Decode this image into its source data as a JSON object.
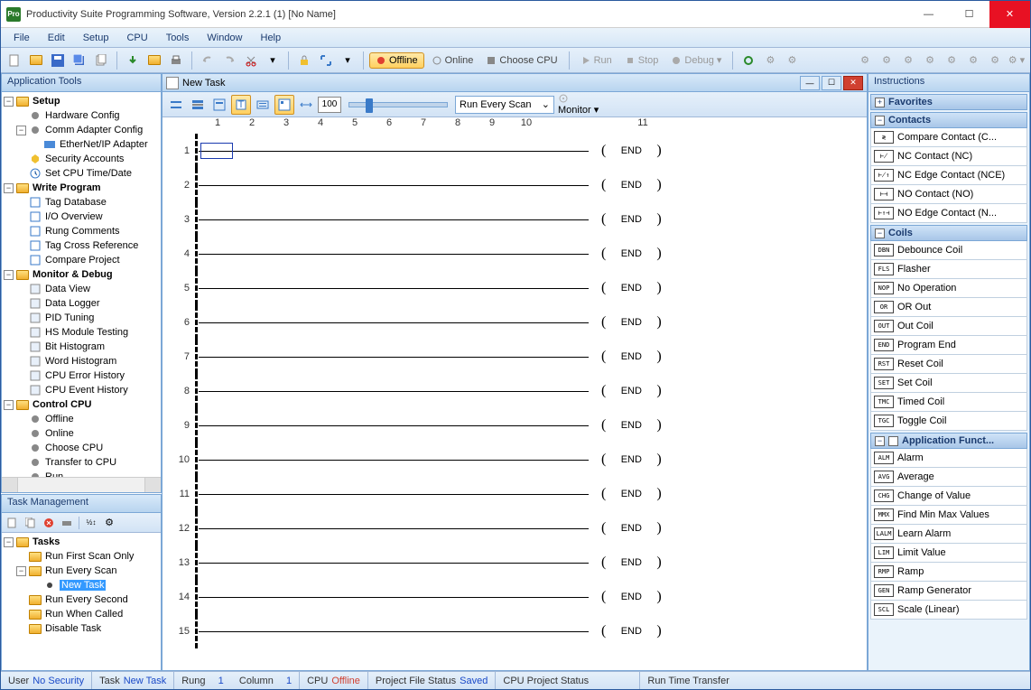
{
  "title": "Productivity Suite Programming Software, Version 2.2.1 (1)   [No Name]",
  "appicon_text": "Pro",
  "menu": [
    "File",
    "Edit",
    "Setup",
    "CPU",
    "Tools",
    "Window",
    "Help"
  ],
  "toolbar_text": {
    "offline": "Offline",
    "online": "Online",
    "choose_cpu": "Choose CPU",
    "run": "Run",
    "stop": "Stop",
    "debug": "Debug"
  },
  "left_panel_title": "Application Tools",
  "tree": {
    "setup": {
      "label": "Setup",
      "items": [
        "Hardware Config",
        "Comm Adapter Config",
        "EtherNet/IP Adapter",
        "Security Accounts",
        "Set CPU Time/Date"
      ]
    },
    "write": {
      "label": "Write Program",
      "items": [
        "Tag Database",
        "I/O Overview",
        "Rung Comments",
        "Tag Cross Reference",
        "Compare Project"
      ]
    },
    "monitor": {
      "label": "Monitor & Debug",
      "items": [
        "Data View",
        "Data Logger",
        "PID Tuning",
        "HS Module Testing",
        "Bit Histogram",
        "Word Histogram",
        "CPU Error History",
        "CPU Event History"
      ]
    },
    "control": {
      "label": "Control CPU",
      "items": [
        "Offline",
        "Online",
        "Choose CPU",
        "Transfer to CPU",
        "Run"
      ]
    }
  },
  "taskmgmt": {
    "title": "Task Management",
    "root": "Tasks",
    "items": [
      "Run First Scan Only",
      "Run Every Scan",
      "New Task",
      "Run Every Second",
      "Run When Called",
      "Disable Task"
    ]
  },
  "doc": {
    "title": "New Task",
    "zoom": "100",
    "combo": "Run Every Scan",
    "monitor": "Monitor",
    "cols": [
      "1",
      "2",
      "3",
      "4",
      "5",
      "6",
      "7",
      "8",
      "9",
      "10",
      "11"
    ],
    "rungs": [
      1,
      2,
      3,
      4,
      5,
      6,
      7,
      8,
      9,
      10,
      11,
      12,
      13,
      14,
      15
    ],
    "end": "END"
  },
  "instr": {
    "title": "Instructions",
    "favorites": "Favorites",
    "contacts": {
      "label": "Contacts",
      "items": [
        {
          "sym": "≷",
          "label": "Compare Contact  (C..."
        },
        {
          "sym": "⊬",
          "label": "NC Contact  (NC)"
        },
        {
          "sym": "⊬↑",
          "label": "NC Edge Contact  (NCE)"
        },
        {
          "sym": "⊢⊣",
          "label": "NO Contact  (NO)"
        },
        {
          "sym": "⊢↑⊣",
          "label": "NO Edge Contact  (N..."
        }
      ]
    },
    "coils": {
      "label": "Coils",
      "items": [
        {
          "sym": "DBN",
          "label": "Debounce Coil"
        },
        {
          "sym": "FLS",
          "label": "Flasher"
        },
        {
          "sym": "NOP",
          "label": "No Operation"
        },
        {
          "sym": "OR",
          "label": "OR Out"
        },
        {
          "sym": "OUT",
          "label": "Out Coil"
        },
        {
          "sym": "END",
          "label": "Program End"
        },
        {
          "sym": "RST",
          "label": "Reset Coil"
        },
        {
          "sym": "SET",
          "label": "Set Coil"
        },
        {
          "sym": "TMC",
          "label": "Timed Coil"
        },
        {
          "sym": "TGC",
          "label": "Toggle Coil"
        }
      ]
    },
    "appfn": {
      "label": "Application Funct...",
      "items": [
        {
          "sym": "ALM",
          "label": "Alarm"
        },
        {
          "sym": "AVG",
          "label": "Average"
        },
        {
          "sym": "CHG",
          "label": "Change of Value"
        },
        {
          "sym": "MMX",
          "label": "Find Min Max Values"
        },
        {
          "sym": "LALM",
          "label": "Learn Alarm"
        },
        {
          "sym": "LIM",
          "label": "Limit Value"
        },
        {
          "sym": "RMP",
          "label": "Ramp"
        },
        {
          "sym": "GEN",
          "label": "Ramp Generator"
        },
        {
          "sym": "SCL",
          "label": "Scale (Linear)"
        }
      ]
    }
  },
  "status": {
    "user_lbl": "User",
    "user_val": "No Security",
    "task_lbl": "Task",
    "task_val": "New Task",
    "rung_lbl": "Rung",
    "rung_val": "1",
    "col_lbl": "Column",
    "col_val": "1",
    "cpu_lbl": "CPU",
    "cpu_val": "Offline",
    "pfs_lbl": "Project File Status",
    "pfs_val": "Saved",
    "cps_lbl": "CPU Project Status",
    "rtt_lbl": "Run Time Transfer"
  }
}
